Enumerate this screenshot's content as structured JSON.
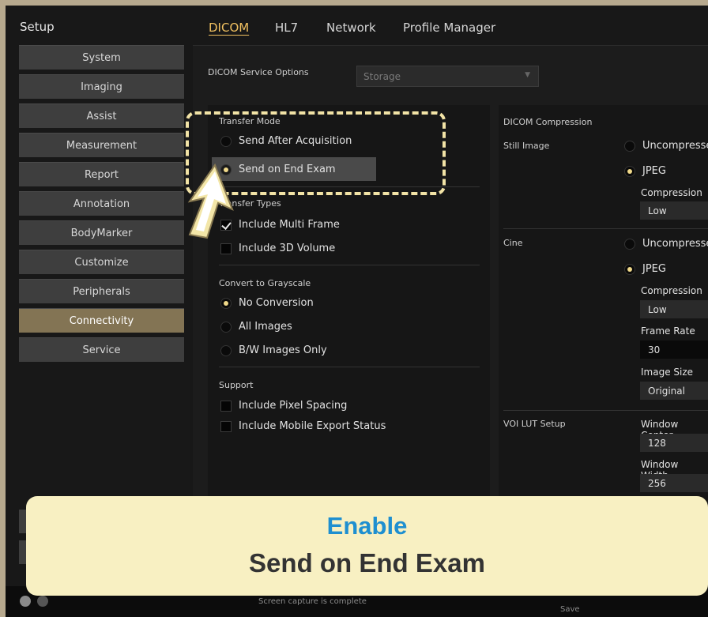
{
  "sidebar": {
    "title": "Setup",
    "items": [
      {
        "label": "System"
      },
      {
        "label": "Imaging"
      },
      {
        "label": "Assist"
      },
      {
        "label": "Measurement"
      },
      {
        "label": "Report"
      },
      {
        "label": "Annotation"
      },
      {
        "label": "BodyMarker"
      },
      {
        "label": "Customize"
      },
      {
        "label": "Peripherals"
      },
      {
        "label": "Connectivity"
      },
      {
        "label": "Service"
      }
    ],
    "active": "Connectivity"
  },
  "tabs": [
    {
      "label": "DICOM",
      "active": true
    },
    {
      "label": "HL7"
    },
    {
      "label": "Network"
    },
    {
      "label": "Profile Manager"
    }
  ],
  "service_options": {
    "label": "DICOM Service Options",
    "value": "Storage"
  },
  "transfer_mode": {
    "title": "Transfer Mode",
    "options": [
      "Send After Acquisition",
      "Send on End Exam"
    ],
    "selected": "Send on End Exam"
  },
  "transfer_types": {
    "title": "Transfer Types",
    "items": [
      {
        "label": "Include Multi Frame",
        "checked": true
      },
      {
        "label": "Include 3D Volume",
        "checked": false
      }
    ]
  },
  "grayscale": {
    "title": "Convert to Grayscale",
    "options": [
      "No Conversion",
      "All Images",
      "B/W Images Only"
    ],
    "selected": "No Conversion"
  },
  "support": {
    "title": "Support",
    "items": [
      {
        "label": "Include Pixel Spacing",
        "checked": false
      },
      {
        "label": "Include Mobile Export Status",
        "checked": false
      }
    ]
  },
  "compression": {
    "title": "DICOM Compression",
    "still_image": {
      "label": "Still Image",
      "options": [
        "Uncompressed",
        "JPEG"
      ],
      "selected": "JPEG",
      "compression_label": "Compression",
      "compression_value": "Low"
    },
    "cine": {
      "label": "Cine",
      "options": [
        "Uncompressed",
        "JPEG"
      ],
      "selected": "JPEG",
      "compression_label": "Compression",
      "compression_value": "Low",
      "frame_rate_label": "Frame Rate",
      "frame_rate_value": "30",
      "image_size_label": "Image Size",
      "image_size_value": "Original"
    },
    "voi": {
      "label": "VOI LUT Setup",
      "window_center_label": "Window Center",
      "window_center_value": "128",
      "window_width_label": "Window Width",
      "window_width_value": "256"
    }
  },
  "status": {
    "message": "Screen capture is complete",
    "save_label": "Save"
  },
  "banner": {
    "line1": "Enable",
    "line2": "Send on End Exam"
  },
  "colors": {
    "accent_tab": "#f0c060",
    "active_sidebar": "#837454",
    "banner_bg": "#f8f0c2",
    "banner_accent": "#1e8fd0",
    "dash_highlight": "#f2e3a6"
  }
}
